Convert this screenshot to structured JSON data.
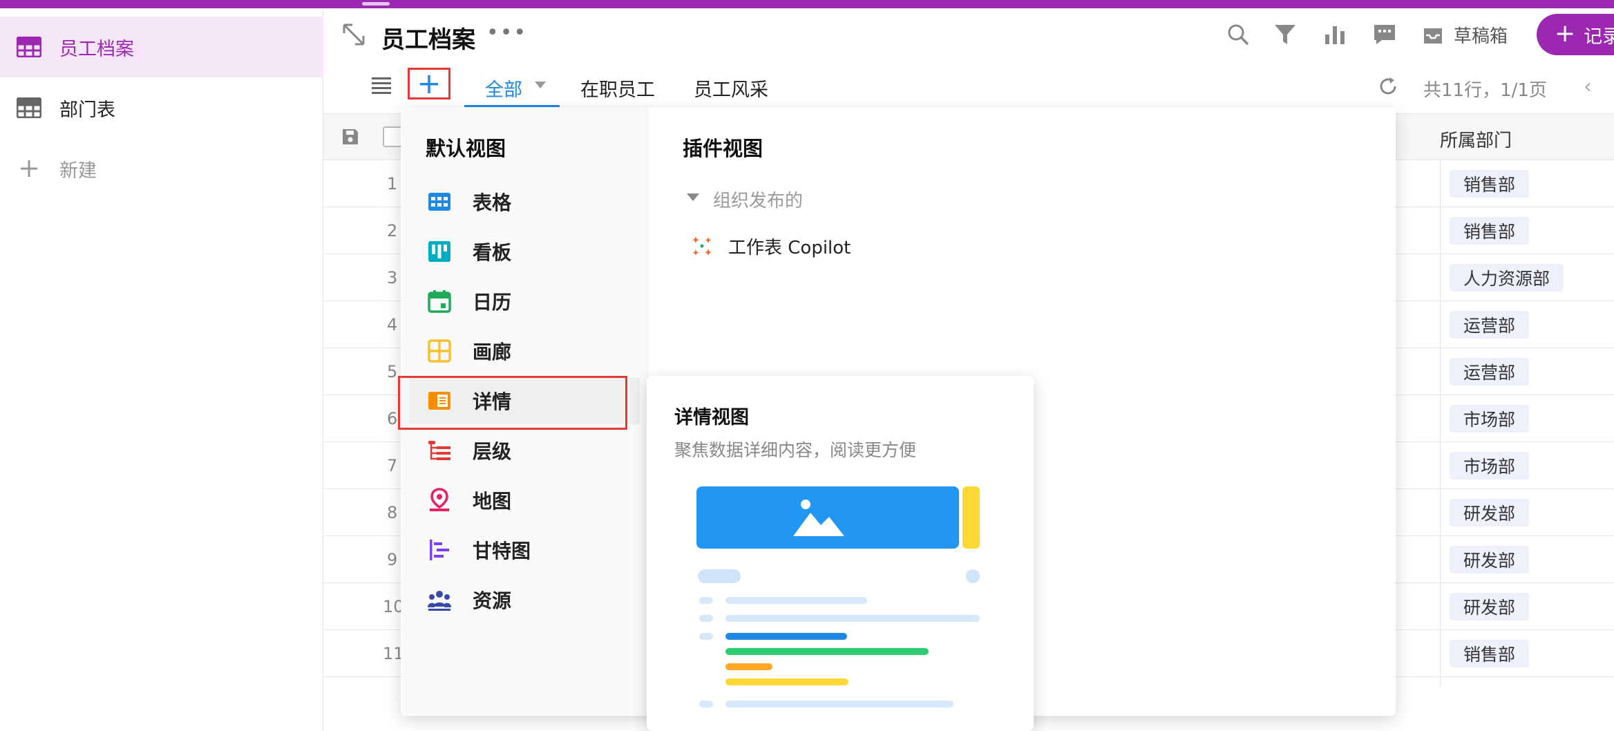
{
  "sidebar": {
    "items": [
      {
        "label": "员工档案",
        "icon": "grid-table-icon",
        "active": true
      },
      {
        "label": "部门表",
        "icon": "grid-table-icon",
        "active": false
      },
      {
        "label": "新建",
        "icon": "plus-icon",
        "active": false
      }
    ]
  },
  "header": {
    "title": "员工档案",
    "more": "•••",
    "draft_label": "草稿箱",
    "record_label": "记录",
    "record_plus": "+"
  },
  "tabs": {
    "add_plus": "+",
    "items": [
      {
        "label": "全部",
        "active": true
      },
      {
        "label": "在职员工",
        "active": false
      },
      {
        "label": "员工风采",
        "active": false
      }
    ],
    "rows_info": "共11行，1/1页",
    "prev": "‹"
  },
  "table": {
    "dept_header": "所属部门",
    "rows": [
      {
        "num": "1",
        "dept": "销售部"
      },
      {
        "num": "2",
        "dept": "销售部"
      },
      {
        "num": "3",
        "dept": "人力资源部"
      },
      {
        "num": "4",
        "dept": "运营部"
      },
      {
        "num": "5",
        "dept": "运营部"
      },
      {
        "num": "6",
        "dept": "市场部"
      },
      {
        "num": "7",
        "dept": "市场部"
      },
      {
        "num": "8",
        "dept": "研发部"
      },
      {
        "num": "9",
        "dept": "研发部"
      },
      {
        "num": "10",
        "dept": "研发部"
      },
      {
        "num": "11",
        "dept": "销售部"
      }
    ]
  },
  "dropdown": {
    "default_heading": "默认视图",
    "views": [
      {
        "label": "表格",
        "icon": "table-view-icon"
      },
      {
        "label": "看板",
        "icon": "kanban-icon"
      },
      {
        "label": "日历",
        "icon": "calendar-icon"
      },
      {
        "label": "画廊",
        "icon": "gallery-icon"
      },
      {
        "label": "详情",
        "icon": "detail-icon"
      },
      {
        "label": "层级",
        "icon": "hierarchy-icon"
      },
      {
        "label": "地图",
        "icon": "map-pin-icon"
      },
      {
        "label": "甘特图",
        "icon": "gantt-icon"
      },
      {
        "label": "资源",
        "icon": "resource-icon"
      }
    ],
    "plugin_heading": "插件视图",
    "plugin_group": "组织发布的",
    "plugin_item": "工作表 Copilot"
  },
  "tooltip": {
    "title": "详情视图",
    "description": "聚焦数据详细内容，阅读更方便"
  },
  "colors": {
    "brand": "#9c27b0",
    "accent": "#1e88e5",
    "highlight": "#e53935"
  }
}
